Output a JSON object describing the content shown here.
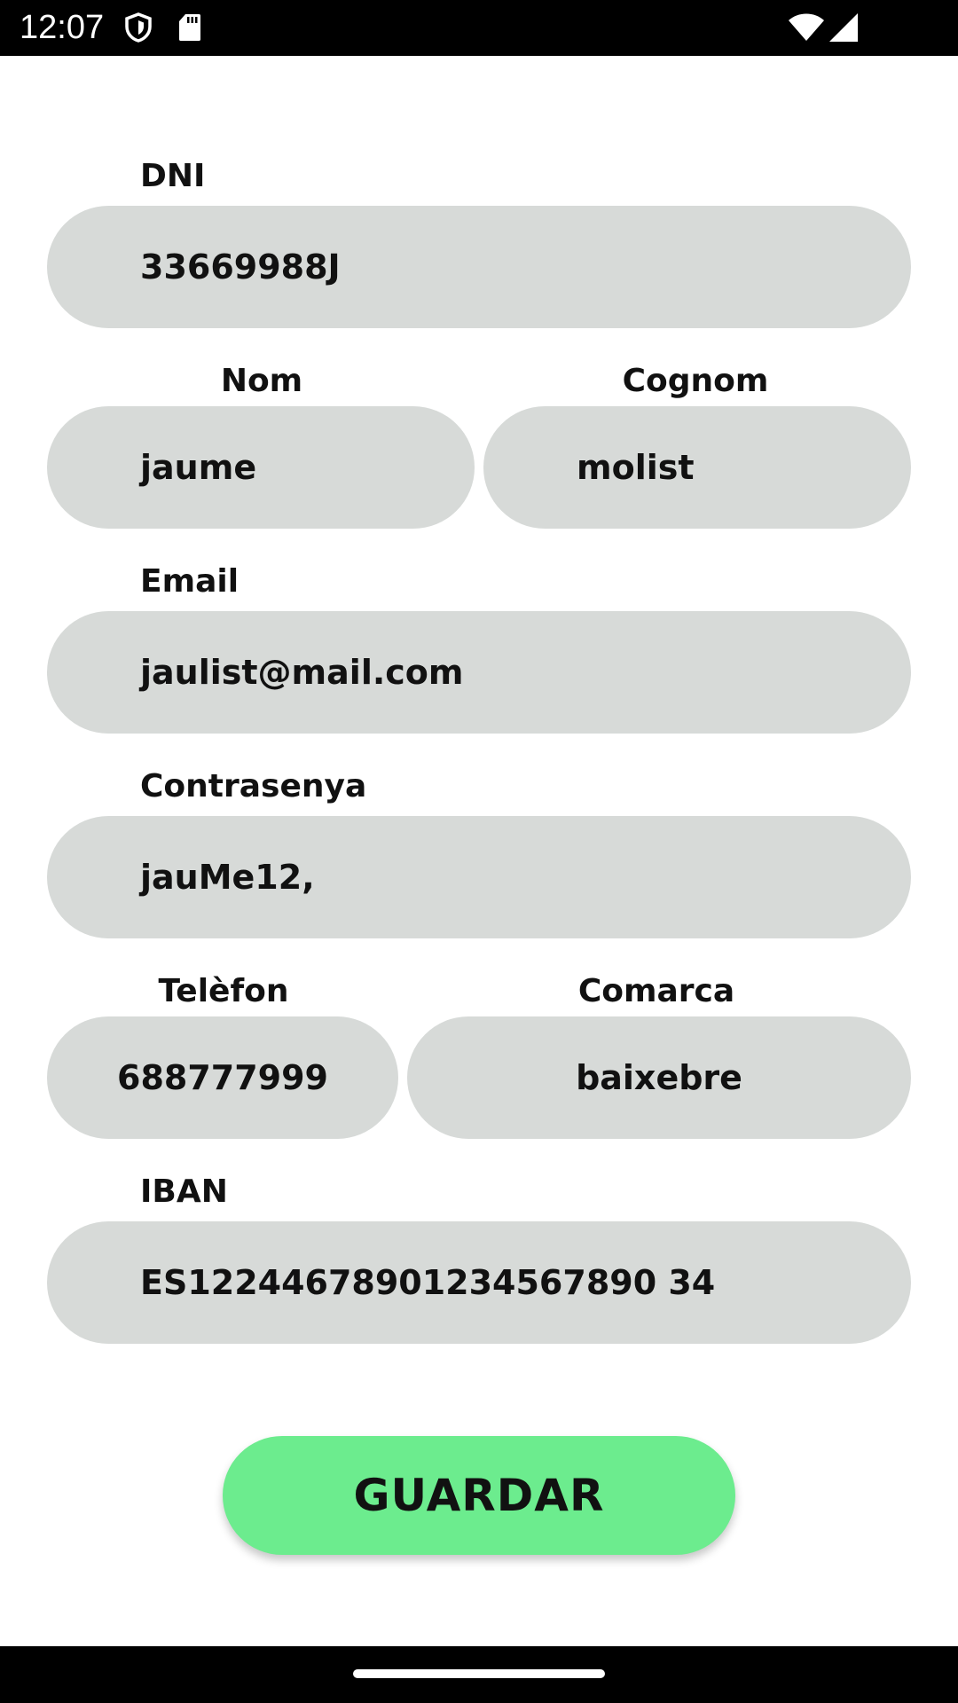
{
  "status_bar": {
    "time": "12:07",
    "icons": [
      "shield-icon",
      "sd-card-icon",
      "wifi-icon",
      "cellular-signal-icon"
    ]
  },
  "form": {
    "dni": {
      "label": "DNI",
      "value": "33669988J"
    },
    "nom": {
      "label": "Nom",
      "value": "jaume"
    },
    "cognom": {
      "label": "Cognom",
      "value": "molist"
    },
    "email": {
      "label": "Email",
      "value": "jaulist@mail.com"
    },
    "contrasenya": {
      "label": "Contrasenya",
      "value": "jauMe12,"
    },
    "telefon": {
      "label": "Telèfon",
      "value": "688777999"
    },
    "comarca": {
      "label": "Comarca",
      "value": "baixebre"
    },
    "iban": {
      "label": "IBAN",
      "value": "ES12244678901234567890 34"
    }
  },
  "actions": {
    "save_label": "GUARDAR"
  },
  "colors": {
    "field_background": "#d7dad8",
    "save_button": "#6cec8e",
    "system_bars": "#000000"
  }
}
